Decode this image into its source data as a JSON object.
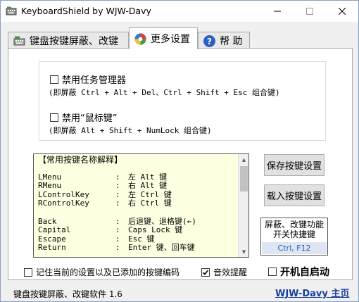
{
  "window": {
    "title": "KeyboardShield by WJW-Davy"
  },
  "tabs": [
    {
      "label": "键盘按键屏蔽、改键"
    },
    {
      "label": "更多设置"
    },
    {
      "label": "帮 助"
    }
  ],
  "options": {
    "taskmgr": {
      "label": "禁用任务管理器",
      "desc": "(即屏蔽 Ctrl + Alt + Del、Ctrl + Shift + Esc 组合键)",
      "checked": false
    },
    "mousekeys": {
      "label": "禁用“鼠标键”",
      "desc": "(即屏蔽 Alt + Shift + NumLock 组合键)",
      "checked": false
    }
  },
  "keylist": {
    "heading": "【常用按键名称解释】",
    "rows": [
      {
        "key": "LMenu",
        "sep": ":",
        "desc": "左 Alt 键"
      },
      {
        "key": "RMenu",
        "sep": ":",
        "desc": "右 Alt 键"
      },
      {
        "key": "LControlKey",
        "sep": ":",
        "desc": "左 Ctrl 键"
      },
      {
        "key": "RControlKey",
        "sep": ":",
        "desc": "右 Ctrl 键"
      },
      {
        "key": "Back",
        "sep": ":",
        "desc": "后退键、退格键(←)"
      },
      {
        "key": "Capital",
        "sep": ":",
        "desc": "Caps Lock 键"
      },
      {
        "key": "Escape",
        "sep": ":",
        "desc": "Esc 键"
      },
      {
        "key": "Return",
        "sep": ":",
        "desc": "Enter 键、回车键"
      }
    ]
  },
  "buttons": {
    "save": "保存按键设置",
    "load": "载入按键设置"
  },
  "hotkey": {
    "title": "屏蔽、改键功能\n开关快捷键",
    "keys": "Ctrl, F12"
  },
  "bottom": {
    "remember": {
      "label": "记住当前的设置以及已添加的按键编码",
      "checked": false
    },
    "sound": {
      "label": "音效提醒",
      "checked": true
    },
    "startup": {
      "label": "开机自启动",
      "checked": false
    }
  },
  "status": {
    "version_text": "键盘按键屏蔽、改键软件 1.6",
    "homepage": "WJW-Davy 主页"
  },
  "colors": {
    "tooltip_bg": "#ffffe1",
    "link": "#1a3fa0",
    "hotkey_text": "#2a5db0"
  }
}
